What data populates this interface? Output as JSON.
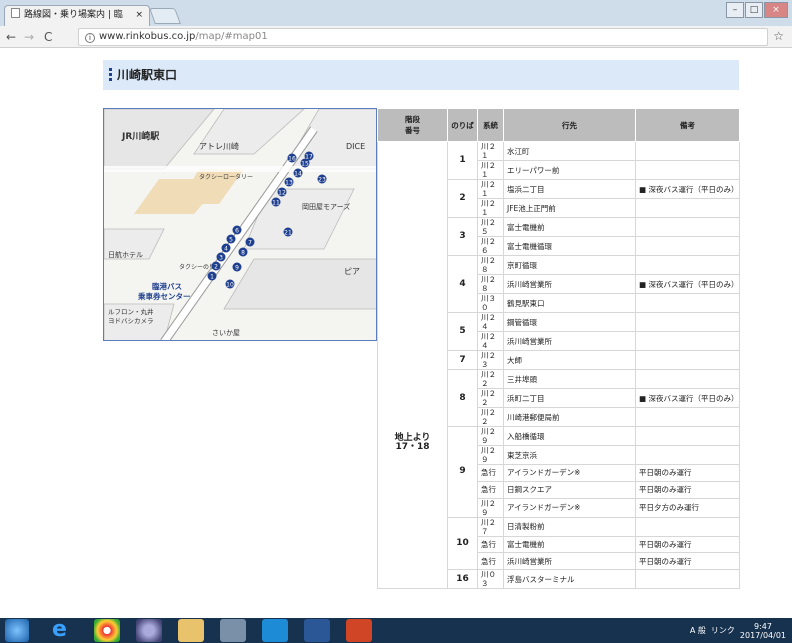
{
  "browser": {
    "tab_title": "路線図・乗り場案内 | 臨",
    "tab_close": "×",
    "url_host": "www.rinkobus.co.jp",
    "url_path": "/map/#map01",
    "win_min": "–",
    "win_max": "□",
    "win_close": "×",
    "back": "←",
    "forward": "→",
    "reload": "C",
    "info": "i",
    "star": "☆"
  },
  "page": {
    "title": "川崎駅東口"
  },
  "map": {
    "labels": {
      "jr": "JR川崎駅",
      "atre": "アトレ川崎",
      "dice": "DICE",
      "rotary": "タクシーロータリー",
      "okada": "岡田屋モアーズ",
      "nikko": "日航ホテル",
      "taxi": "タクシーのりば",
      "center": "臨港バス\n乗車券センター",
      "pia": "ピア",
      "lufron": "ルフロン・丸井\nヨドバシカメラ",
      "saikaya": "さいか屋"
    }
  },
  "table": {
    "headers": [
      "階段\n番号",
      "のりば",
      "系統",
      "行先",
      "備考"
    ],
    "stairs": "地上より\n17・18",
    "rows": [
      {
        "p": "1",
        "k": "川２１",
        "d": "水江町",
        "n": ""
      },
      {
        "p": "",
        "k": "川２１",
        "d": "エリーパワー前",
        "n": ""
      },
      {
        "p": "2",
        "k": "川２１",
        "d": "塩浜二丁目",
        "n": "■ 深夜バス運行（平日のみ）"
      },
      {
        "p": "",
        "k": "川２１",
        "d": "JFE池上正門前",
        "n": ""
      },
      {
        "p": "3",
        "k": "川２５",
        "d": "富士電機前",
        "n": ""
      },
      {
        "p": "",
        "k": "川２６",
        "d": "富士電機循環",
        "n": ""
      },
      {
        "p": "4",
        "k": "川２８",
        "d": "京町循環",
        "n": ""
      },
      {
        "p": "",
        "k": "川２８",
        "d": "浜川崎営業所",
        "n": "■ 深夜バス運行（平日のみ）"
      },
      {
        "p": "",
        "k": "川３０",
        "d": "鶴見駅東口",
        "n": ""
      },
      {
        "p": "5",
        "k": "川２４",
        "d": "鋼管循環",
        "n": ""
      },
      {
        "p": "",
        "k": "川２４",
        "d": "浜川崎営業所",
        "n": ""
      },
      {
        "p": "7",
        "k": "川２３",
        "d": "大師",
        "n": ""
      },
      {
        "p": "8",
        "k": "川２２",
        "d": "三井埠頭",
        "n": ""
      },
      {
        "p": "",
        "k": "川２２",
        "d": "浜町二丁目",
        "n": "■ 深夜バス運行（平日のみ）"
      },
      {
        "p": "",
        "k": "川２２",
        "d": "川崎港郵便局前",
        "n": ""
      },
      {
        "p": "9",
        "k": "川２９",
        "d": "入船橋循環",
        "n": ""
      },
      {
        "p": "",
        "k": "川２９",
        "d": "東芝京浜",
        "n": ""
      },
      {
        "p": "",
        "k": "急行",
        "d": "アイランドガーデン※",
        "n": "平日朝のみ運行"
      },
      {
        "p": "",
        "k": "急行",
        "d": "日鋼スクエア",
        "n": "平日朝のみ運行"
      },
      {
        "p": "",
        "k": "川２９",
        "d": "アイランドガーデン※",
        "n": "平日夕方のみ運行"
      },
      {
        "p": "10",
        "k": "川２７",
        "d": "日清製粉前",
        "n": ""
      },
      {
        "p": "",
        "k": "急行",
        "d": "富士電機前",
        "n": "平日朝のみ運行"
      },
      {
        "p": "",
        "k": "急行",
        "d": "浜川崎営業所",
        "n": "平日朝のみ運行"
      },
      {
        "p": "16",
        "k": "川０３",
        "d": "浮島バスターミナル",
        "n": ""
      }
    ],
    "spans": {
      "1": 2,
      "2": 2,
      "3": 2,
      "4": 3,
      "5": 2,
      "7": 1,
      "8": 3,
      "9": 5,
      "10": 3,
      "16": 1
    }
  },
  "taskbar": {
    "tray_text": "A 般",
    "link": "リンク",
    "time": "9:47",
    "date": "2017/04/01"
  },
  "colors": {
    "header_bg": "#dbe9f8",
    "accent": "#1f3f8f",
    "table_head": "#bcbcbc",
    "taskbar": "#17324f"
  }
}
